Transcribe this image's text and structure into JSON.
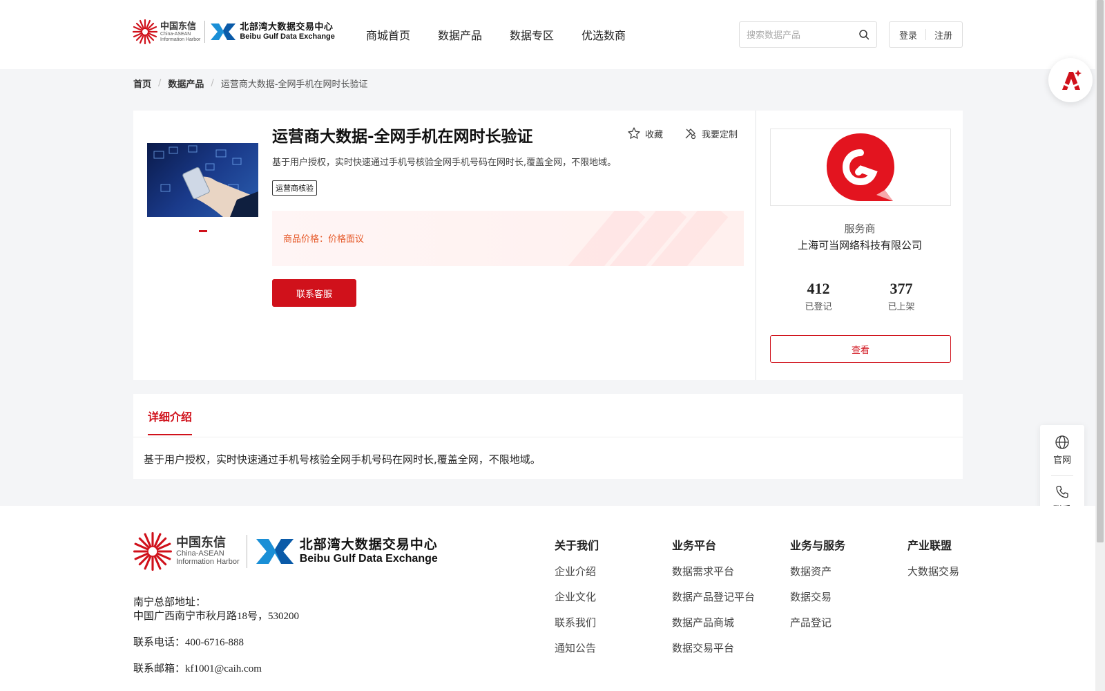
{
  "header": {
    "logo": {
      "caih_cn": "中国东信",
      "caih_en1": "China-ASEAN",
      "caih_en2": "Information Harbor",
      "bgde_cn": "北部湾大数据交易中心",
      "bgde_en": "Beibu Gulf Data Exchange"
    },
    "nav": [
      "商城首页",
      "数据产品",
      "数据专区",
      "优选数商"
    ],
    "search_placeholder": "搜索数据产品",
    "login": "登录",
    "register": "注册"
  },
  "breadcrumb": {
    "home": "首页",
    "category": "数据产品",
    "current": "运营商大数据-全网手机在网时长验证"
  },
  "product": {
    "title": "运营商大数据-全网手机在网时长验证",
    "favorite_label": "收藏",
    "custom_label": "我要定制",
    "description": "基于用户授权，实时快速通过手机号核验全网手机号码在网时长,覆盖全网，不限地域。",
    "tag": "运营商核验",
    "price_text": "商品价格：价格面议",
    "contact_button": "联系客服"
  },
  "provider": {
    "role": "服务商",
    "name": "上海可当网络科技有限公司",
    "stats": [
      {
        "value": "412",
        "label": "已登记"
      },
      {
        "value": "377",
        "label": "已上架"
      }
    ],
    "view_button": "查看"
  },
  "detail": {
    "tab_label": "详细介绍",
    "text": "基于用户授权，实时快速通过手机号核验全网手机号码在网时长,覆盖全网，不限地域。"
  },
  "float_bar": {
    "official": "官网",
    "contact": "联系"
  },
  "footer": {
    "address_label": "南宁总部地址：",
    "address": "中国广西南宁市秋月路18号，530200",
    "phone": "联系电话：400-6716-888",
    "email": "联系邮箱：kf1001@caih.com",
    "columns": [
      {
        "title": "关于我们",
        "links": [
          "企业介绍",
          "企业文化",
          "联系我们",
          "通知公告"
        ]
      },
      {
        "title": "业务平台",
        "links": [
          "数据需求平台",
          "数据产品登记平台",
          "数据产品商城",
          "数据交易平台"
        ]
      },
      {
        "title": "业务与服务",
        "links": [
          "数据资产",
          "数据交易",
          "产品登记"
        ]
      },
      {
        "title": "产业联盟",
        "links": [
          "大数据交易"
        ]
      }
    ]
  },
  "colors": {
    "brand_red": "#d0111b",
    "price_orange": "#e65a2a",
    "bg_gray": "#f4f5f7"
  }
}
